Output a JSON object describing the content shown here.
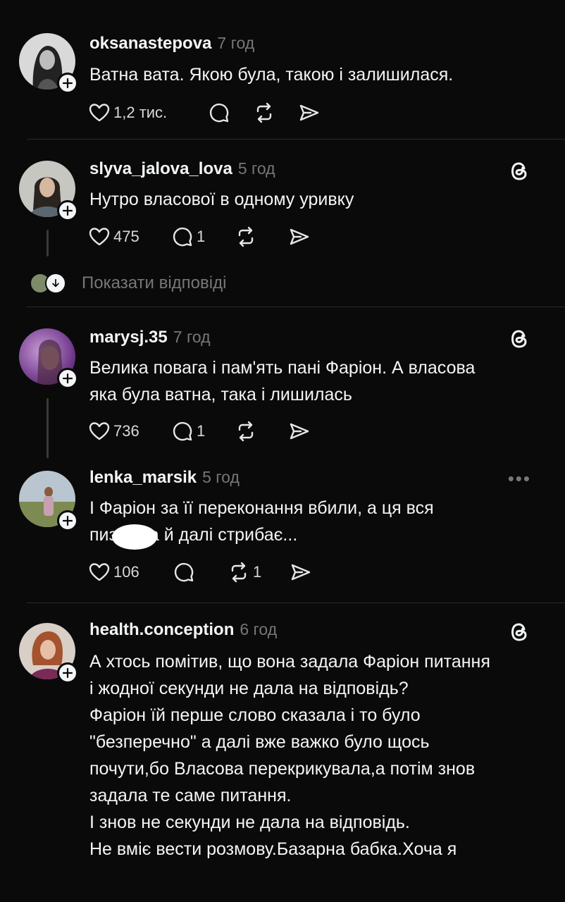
{
  "colors": {
    "background": "#0a0a0a",
    "text": "#f3f5f7",
    "muted": "#777777"
  },
  "posts": [
    {
      "username": "oksanastepova",
      "time": "7 год",
      "text": [
        "Ватна вата. Якою була, такою і залишилася."
      ],
      "likes": "1,2 тис.",
      "replies": "",
      "reposts": ""
    },
    {
      "username": "slyva_jalova_lova",
      "time": "5 год",
      "text": [
        "Нутро власової в одному уривку"
      ],
      "likes": "475",
      "replies": "1",
      "reposts": ""
    },
    {
      "username": "marysj.35",
      "time": "7 год",
      "text": [
        "Велика повага і пам'ять пані Фаріон. А власова",
        "яка була ватна, така і лишилась"
      ],
      "likes": "736",
      "replies": "1",
      "reposts": ""
    },
    {
      "username": "lenka_marsik",
      "time": "5 год",
      "text": [
        "І Фаріон за її переконання вбили, а ця вся",
        "пиз     та й далі стрибає..."
      ],
      "likes": "106",
      "replies": "",
      "reposts": "1"
    },
    {
      "username": "health.conception",
      "time": "6 год",
      "text": [
        "А хтось помітив, що вона задала Фаріон питання",
        "і жодної секунди не дала на відповідь?",
        "Фаріон їй перше слово сказала і то було",
        "\"безперечно\" а далі вже важко було щось",
        "почути,бо Власова перекрикувала,а потім знов",
        "задала те саме питання.",
        "І знов не секунди не дала на відповідь.",
        "Не вміє вести розмову.Базарна бабка.Хоча я"
      ]
    }
  ],
  "show_replies": {
    "label": "Показати відповіді"
  },
  "icons": [
    "heart-icon",
    "comment-icon",
    "repost-icon",
    "share-icon",
    "threads-logo-icon",
    "plus-icon",
    "more-icon",
    "arrow-down-icon"
  ]
}
